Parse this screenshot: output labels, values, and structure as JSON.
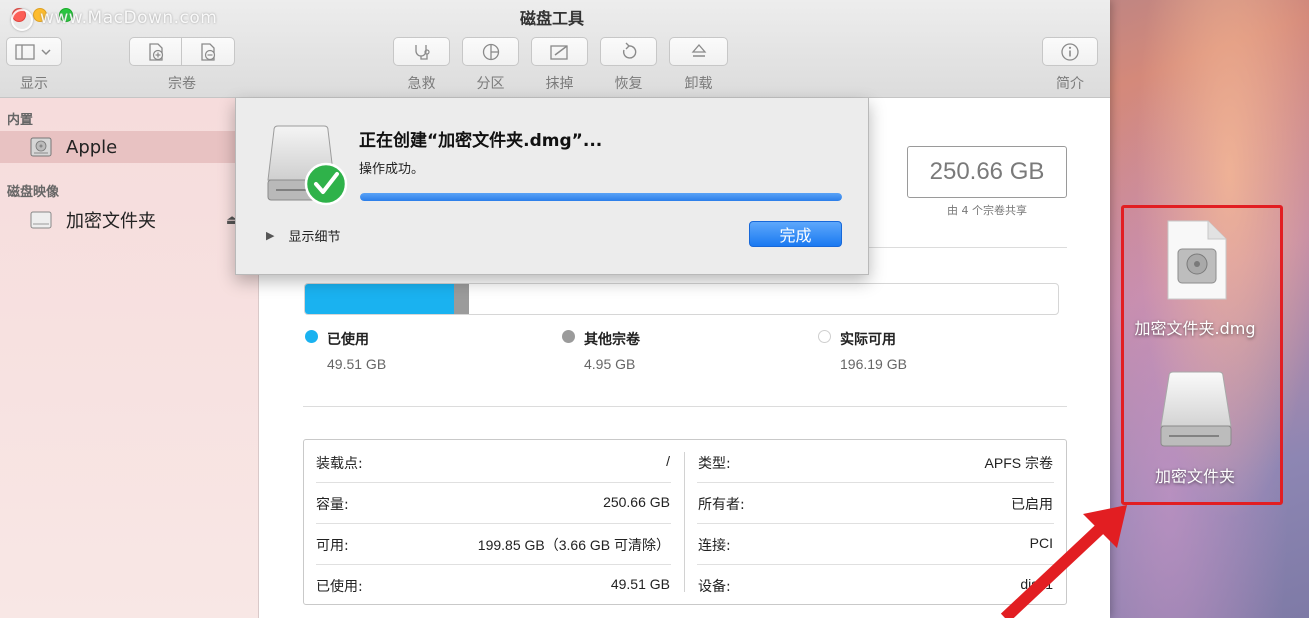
{
  "window": {
    "title": "磁盘工具",
    "watermark": "www.MacDown.com"
  },
  "toolbar": {
    "view_label": "显示",
    "volume_label": "宗卷",
    "first_aid_label": "急救",
    "partition_label": "分区",
    "erase_label": "抹掉",
    "restore_label": "恢复",
    "unmount_label": "卸载",
    "info_label": "简介"
  },
  "sidebar": {
    "section_internal": "内置",
    "internal_item": "Apple",
    "section_images": "磁盘映像",
    "image_item": "加密文件夹"
  },
  "dialog": {
    "title": "正在创建“加密文件夹.dmg”...",
    "status": "操作成功。",
    "progress": 1.0,
    "details_label": "显示细节",
    "done_label": "完成"
  },
  "volume": {
    "capacity": "250.66 GB",
    "shared_note": "由 4 个宗卷共享",
    "used_fraction": 0.1975,
    "other_fraction": 0.0197,
    "legend": [
      {
        "name": "已使用",
        "value": "49.51 GB",
        "color": "#1ab2f0"
      },
      {
        "name": "其他宗卷",
        "value": "4.95 GB",
        "color": "#9b9b9b"
      },
      {
        "name": "实际可用",
        "value": "196.19 GB",
        "color": "#ffffff"
      }
    ]
  },
  "info": {
    "mount_point_key": "装载点:",
    "mount_point_val": "/",
    "capacity_key": "容量:",
    "capacity_val": "250.66 GB",
    "available_key": "可用:",
    "available_val": "199.85 GB（3.66 GB 可清除）",
    "used_key": "已使用:",
    "used_val": "49.51 GB",
    "type_key": "类型:",
    "type_val": "APFS 宗卷",
    "owners_key": "所有者:",
    "owners_val": "已启用",
    "connection_key": "连接:",
    "connection_val": "PCI",
    "device_key": "设备:",
    "device_val": "disk1"
  },
  "desktop": {
    "dmg_label": "加密文件夹.dmg",
    "volume_label": "加密文件夹",
    "highlight_color": "#e21e22"
  }
}
